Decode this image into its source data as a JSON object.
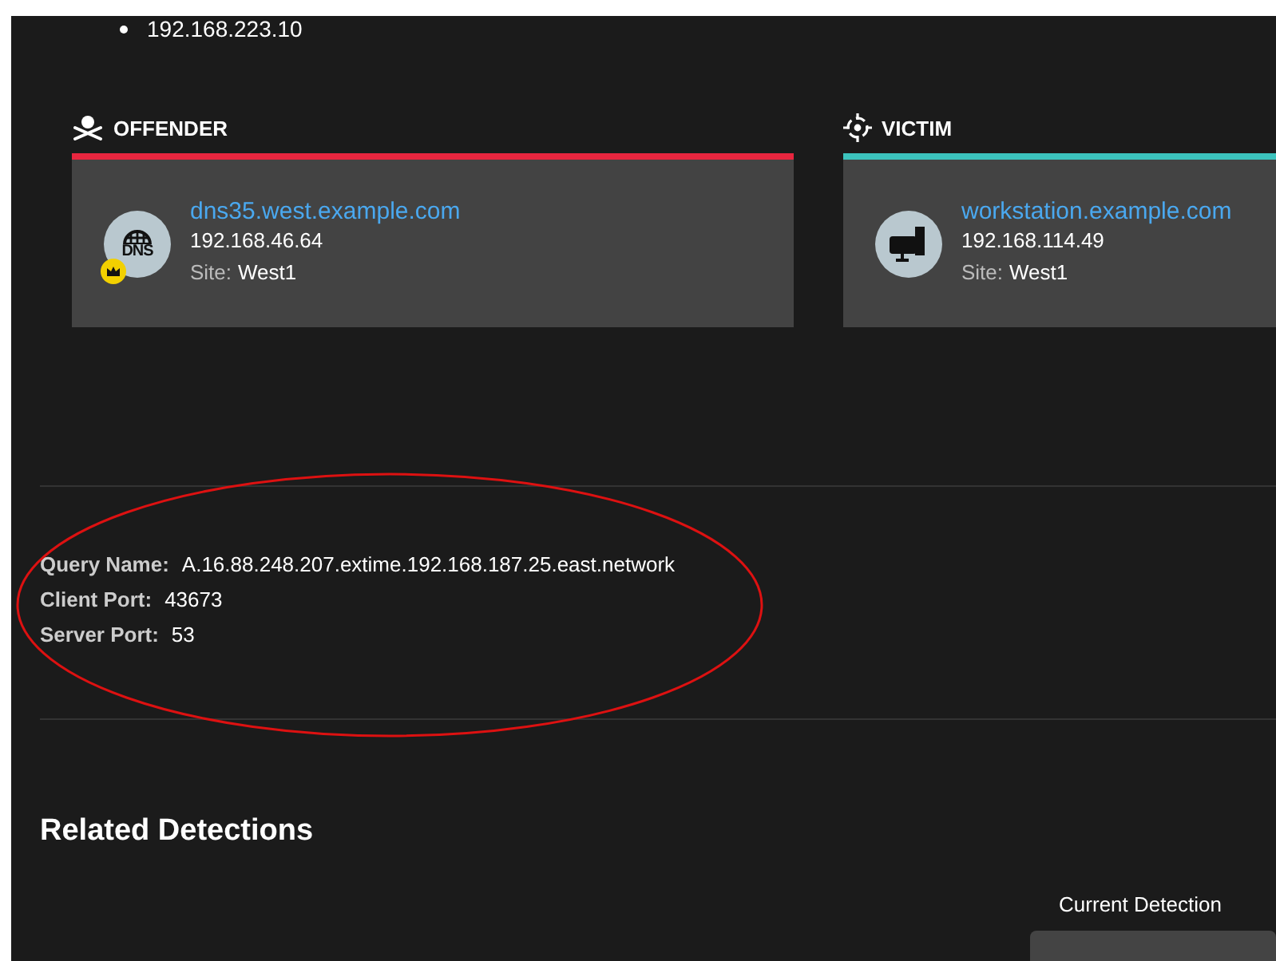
{
  "addresses": [
    "192.168.223.10"
  ],
  "participants": [
    {
      "role": {
        "label": "OFFENDER",
        "kind": "offender"
      },
      "color": "#e8263f",
      "host": {
        "kind": "dns",
        "icon_text": "DNS",
        "crown": true,
        "name": "dns35.west.example.com",
        "ip": "192.168.46.64",
        "site_label": "Site:",
        "site": "West1"
      }
    },
    {
      "role": {
        "label": "VICTIM",
        "kind": "victim"
      },
      "color": "#3cc3bd",
      "host": {
        "kind": "workstation",
        "crown": false,
        "name": "workstation.example.com",
        "ip": "192.168.114.49",
        "site_label": "Site:",
        "site": "West1"
      }
    }
  ],
  "details": [
    {
      "label": "Query Name:",
      "value": "A.16.88.248.207.extime.192.168.187.25.east.network"
    },
    {
      "label": "Client Port:",
      "value": "43673"
    },
    {
      "label": "Server Port:",
      "value": "53"
    }
  ],
  "related": {
    "title": "Related Detections",
    "current_label": "Current Detection"
  }
}
